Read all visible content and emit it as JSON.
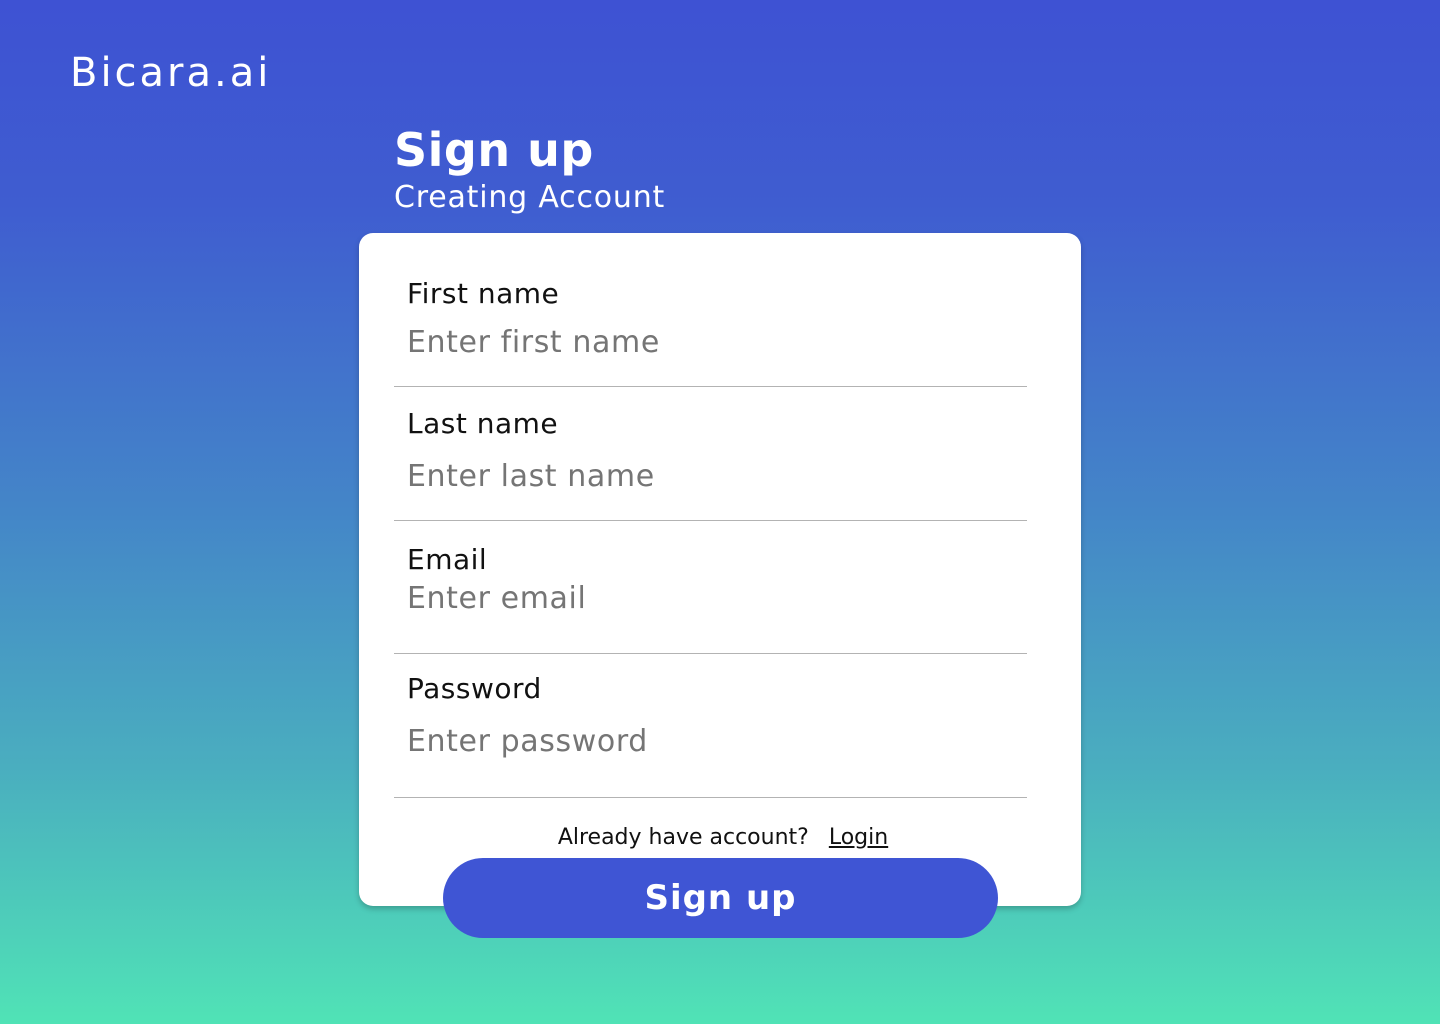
{
  "brand": {
    "name": "Bicara.ai"
  },
  "header": {
    "title": "Sign up",
    "subtitle": "Creating Account"
  },
  "form": {
    "fields": [
      {
        "label": "First name",
        "placeholder": "Enter first name",
        "value": ""
      },
      {
        "label": "Last name",
        "placeholder": "Enter last name",
        "value": ""
      },
      {
        "label": "Email",
        "placeholder": "Enter email",
        "value": ""
      },
      {
        "label": "Password",
        "placeholder": "Enter password",
        "value": ""
      }
    ],
    "login_prompt": "Already have account?",
    "login_link": "Login",
    "submit_label": "Sign up"
  },
  "colors": {
    "gradient_top": "#3e52d3",
    "gradient_bottom": "#50e3b6",
    "button": "#3f55d4",
    "card": "#ffffff"
  }
}
